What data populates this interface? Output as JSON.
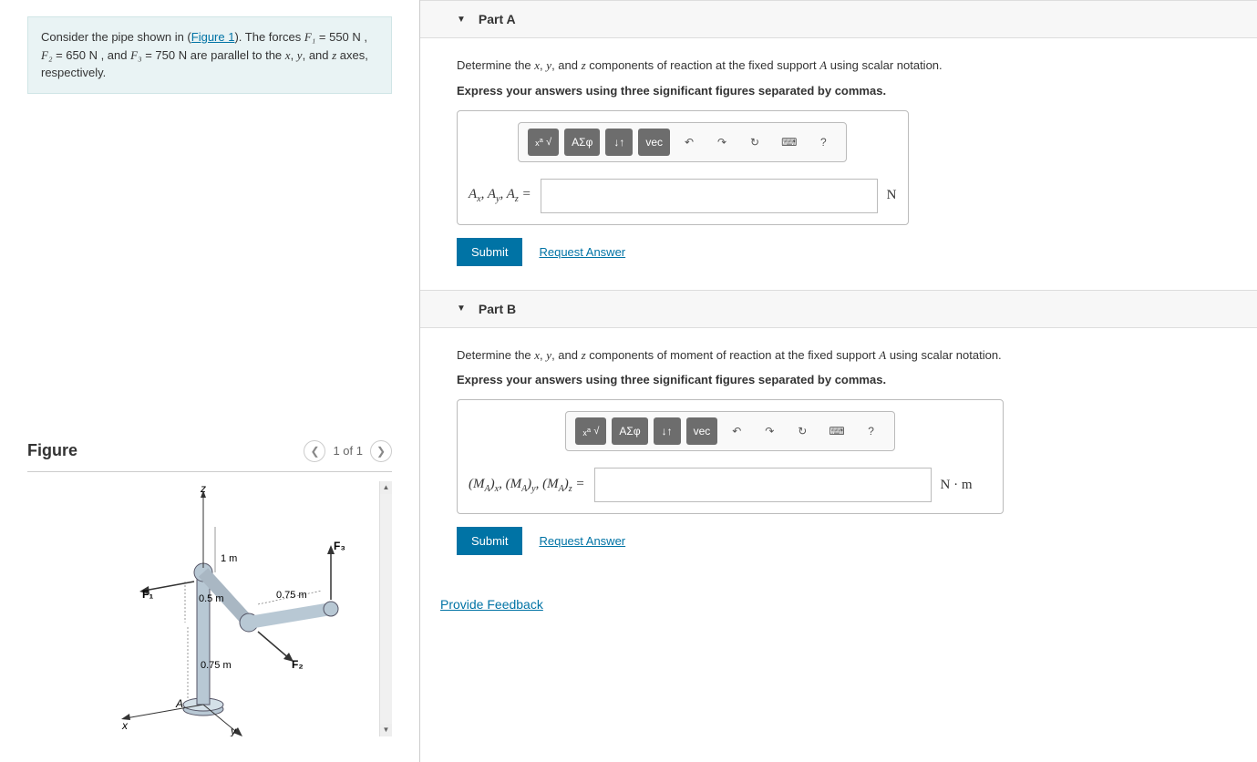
{
  "problem": {
    "text_pre": "Consider the pipe shown in (",
    "figure_link": "Figure 1",
    "text_post1": "). The forces ",
    "F1": "F₁",
    "F1_val": " = 550 N , ",
    "F2": "F₂",
    "F2_val": " = 650 N , and ",
    "F3": "F₃",
    "F3_val": " = 750 N are parallel to the ",
    "x": "x",
    "y": "y",
    "z": "z",
    "text_end": " axes, respectively."
  },
  "figure": {
    "title": "Figure",
    "nav": "1 of 1",
    "labels": {
      "z": "z",
      "y": "y",
      "x": "x",
      "A": "A",
      "F1": "F₁",
      "F2": "F₂",
      "F3": "F₃",
      "d1": "1 m",
      "d2": "0.5 m",
      "d3": "0.75 m",
      "d4": "0.75 m"
    }
  },
  "partA": {
    "title": "Part A",
    "prompt_pre": "Determine the ",
    "prompt_mid": " components of reaction at the fixed support ",
    "A": "A",
    "prompt_end": " using scalar notation.",
    "instruct": "Express your answers using three significant figures separated by commas.",
    "vars": "Aₓ, Aᵧ, A_z =",
    "unit": "N",
    "submit": "Submit",
    "request": "Request Answer"
  },
  "partB": {
    "title": "Part B",
    "prompt_pre": "Determine the ",
    "prompt_mid": " components of moment of reaction at the fixed support ",
    "A": "A",
    "prompt_end": " using scalar notation.",
    "instruct": "Express your answers using three significant figures separated by commas.",
    "vars": "(M_A)ₓ, (M_A)ᵧ, (M_A)_z =",
    "unit": "N · m",
    "submit": "Submit",
    "request": "Request Answer"
  },
  "toolbar": {
    "template": "▮√▯",
    "greek": "ΑΣφ",
    "sub": "↓↑",
    "vec": "vec",
    "undo": "↶",
    "redo": "↷",
    "reset": "↻",
    "keyboard": "⌨",
    "help": "?"
  },
  "feedback": "Provide Feedback",
  "comma": ", ",
  "and": "and "
}
